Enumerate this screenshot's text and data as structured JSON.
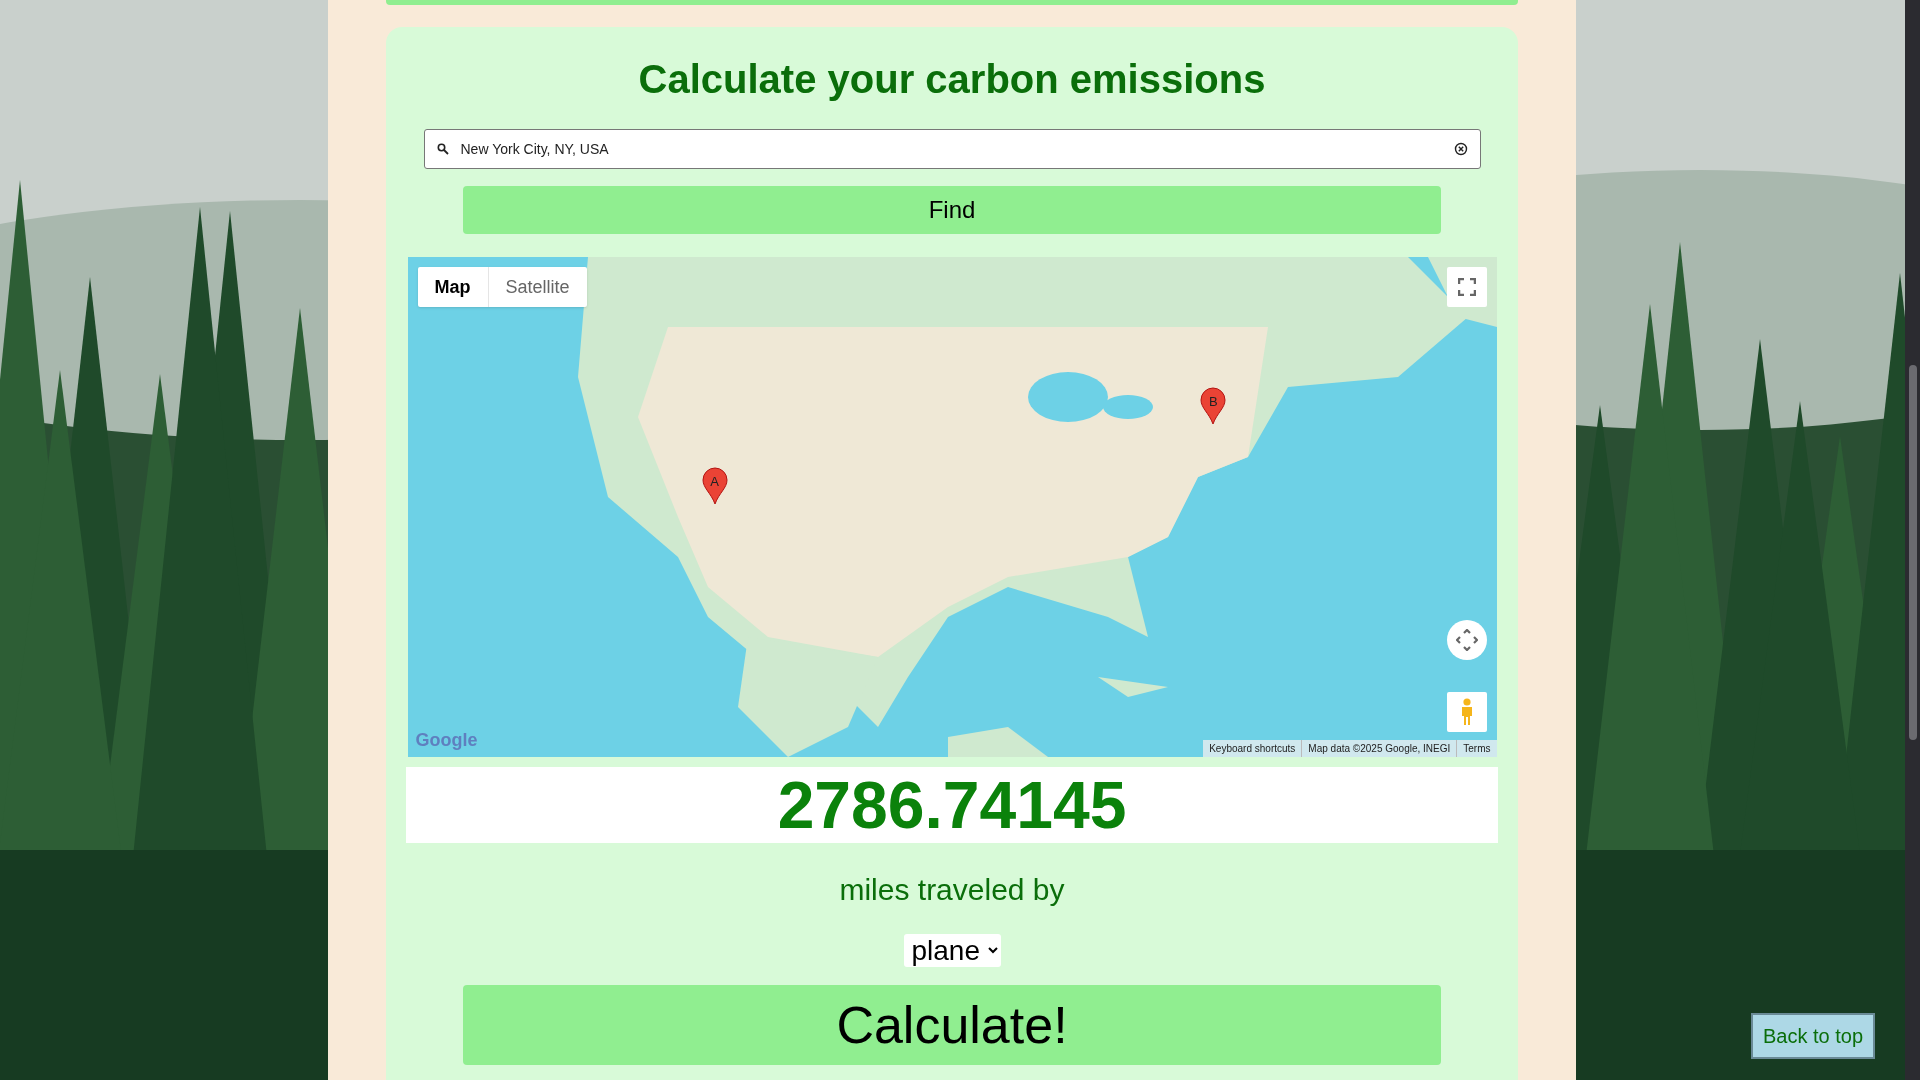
{
  "title": "Calculate your carbon emissions",
  "search": {
    "value": "New York City, NY, USA"
  },
  "find_button": "Find",
  "map": {
    "type_tabs": [
      {
        "label": "Map",
        "selected": true
      },
      {
        "label": "Satellite",
        "selected": false
      }
    ],
    "markers": [
      {
        "label": "A"
      },
      {
        "label": "B"
      }
    ],
    "logo": "Google",
    "footer": [
      "Keyboard shortcuts",
      "Map data ©2025 Google, INEGI",
      "Terms"
    ]
  },
  "result": "2786.74145",
  "caption": "miles traveled by",
  "mode": {
    "value": "plane"
  },
  "calculate_button": "Calculate!",
  "back_to_top": "Back to top"
}
